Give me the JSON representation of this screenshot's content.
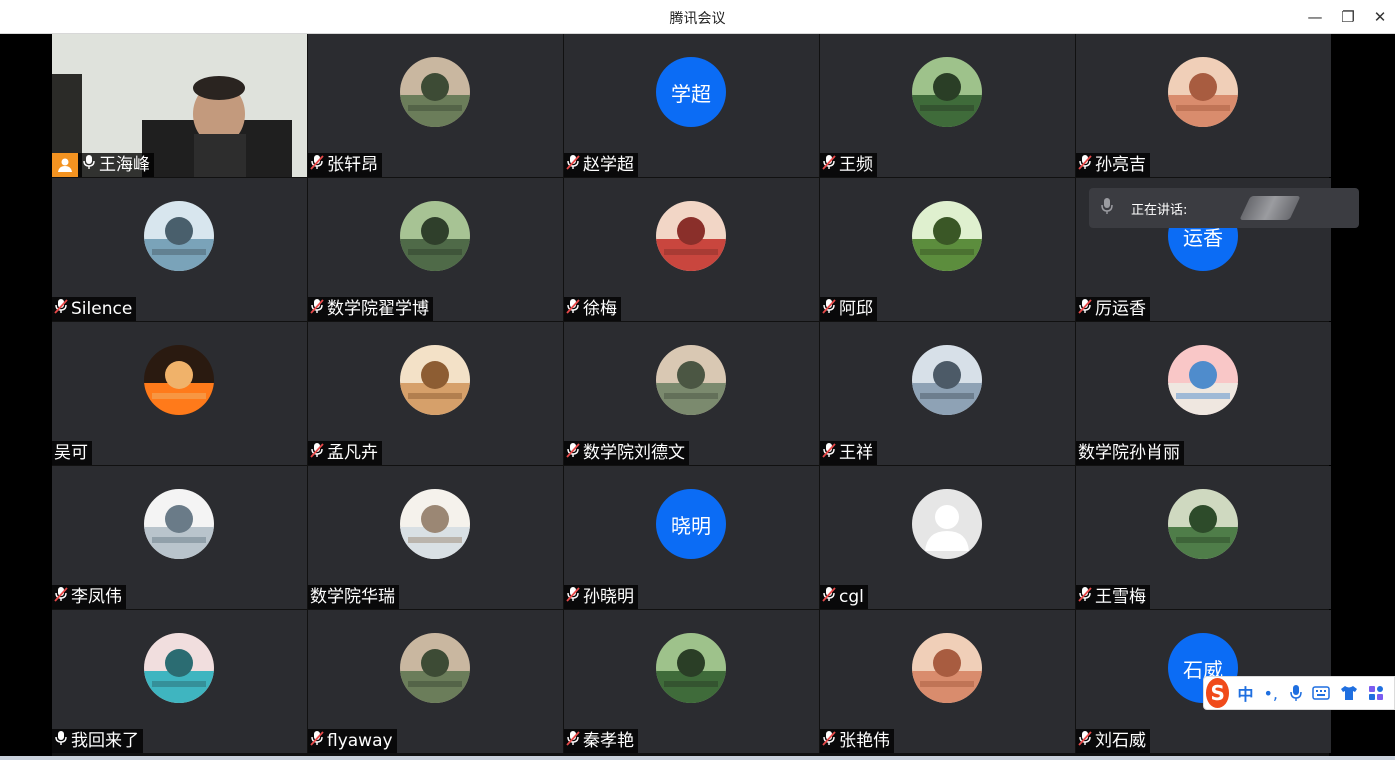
{
  "window": {
    "title": "腾讯会议",
    "controls": {
      "minimize": "—",
      "restore": "❐",
      "close": "✕"
    }
  },
  "speaking_indicator": {
    "label": "正在讲话:"
  },
  "participants": [
    {
      "name": "王海峰",
      "mic": "on",
      "host": true,
      "avatar": "video-feed"
    },
    {
      "name": "张轩昂",
      "mic": "muted",
      "avatar": "photo"
    },
    {
      "name": "赵学超",
      "mic": "muted",
      "avatar": "text",
      "avatar_text": "学超"
    },
    {
      "name": "王频",
      "mic": "muted",
      "avatar": "photo"
    },
    {
      "name": "孙亮吉",
      "mic": "muted",
      "avatar": "photo"
    },
    {
      "name": "Silence",
      "mic": "muted",
      "avatar": "photo"
    },
    {
      "name": "数学院翟学博",
      "mic": "muted",
      "avatar": "photo"
    },
    {
      "name": "徐梅",
      "mic": "muted",
      "avatar": "photo"
    },
    {
      "name": "阿邱",
      "mic": "muted",
      "avatar": "photo"
    },
    {
      "name": "厉运香",
      "mic": "muted",
      "avatar": "text",
      "avatar_text": "运香"
    },
    {
      "name": "吴可",
      "mic": "none",
      "avatar": "photo"
    },
    {
      "name": "孟凡卉",
      "mic": "muted",
      "avatar": "photo"
    },
    {
      "name": "数学院刘德文",
      "mic": "muted",
      "avatar": "photo"
    },
    {
      "name": "王祥",
      "mic": "muted",
      "avatar": "photo"
    },
    {
      "name": "数学院孙肖丽",
      "mic": "none",
      "avatar": "photo"
    },
    {
      "name": "李凤伟",
      "mic": "muted",
      "avatar": "photo"
    },
    {
      "name": "数学院华瑞",
      "mic": "none",
      "avatar": "photo"
    },
    {
      "name": "孙晓明",
      "mic": "muted",
      "avatar": "text",
      "avatar_text": "晓明"
    },
    {
      "name": "cgl",
      "mic": "muted",
      "avatar": "generic"
    },
    {
      "name": "王雪梅",
      "mic": "muted",
      "avatar": "photo"
    },
    {
      "name": "我回来了",
      "mic": "on",
      "avatar": "photo"
    },
    {
      "name": "flyaway",
      "mic": "muted",
      "avatar": "photo"
    },
    {
      "name": "秦孝艳",
      "mic": "muted",
      "avatar": "photo"
    },
    {
      "name": "张艳伟",
      "mic": "muted",
      "avatar": "photo"
    },
    {
      "name": "刘石威",
      "mic": "muted",
      "avatar": "text",
      "avatar_text": "石威"
    }
  ],
  "ime_toolbar": {
    "logo": "S",
    "mode": "中",
    "punct": "•,"
  },
  "colors": {
    "tile_bg": "#2b2c30",
    "avatar_blue": "#0b6cf5",
    "host_badge": "#f39321",
    "ime_logo": "#f04a1a"
  }
}
